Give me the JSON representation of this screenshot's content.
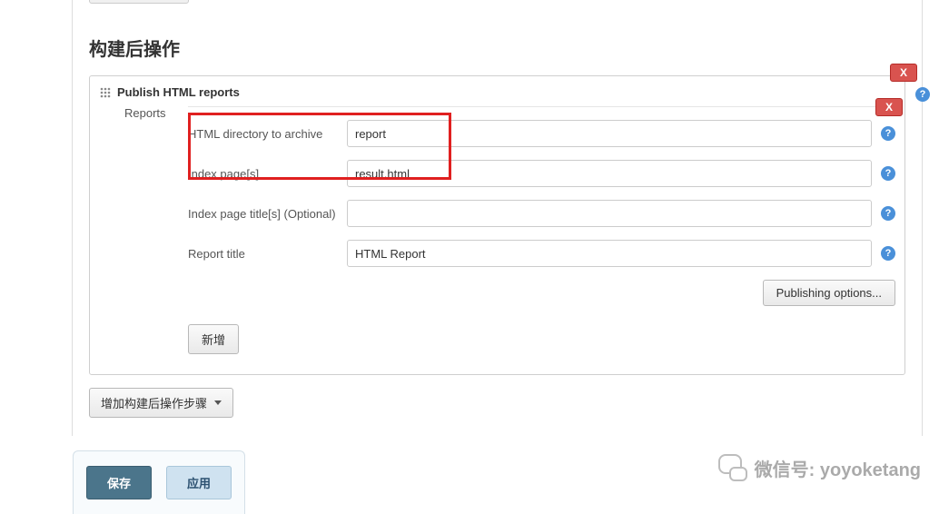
{
  "section": {
    "title": "构建后操作"
  },
  "panel": {
    "title": "Publish HTML reports",
    "reports_label": "Reports",
    "close_label": "X",
    "inner_close_label": "X"
  },
  "fields": {
    "html_dir": {
      "label": "HTML directory to archive",
      "value": "report"
    },
    "index_pages": {
      "label": "Index page[s]",
      "value": "result.html"
    },
    "index_titles": {
      "label": "Index page title[s] (Optional)",
      "value": ""
    },
    "report_title": {
      "label": "Report title",
      "value": "HTML Report"
    }
  },
  "buttons": {
    "publishing_options": "Publishing options...",
    "add": "新增",
    "add_post_step": "增加构建后操作步骤",
    "save": "保存",
    "apply": "应用"
  },
  "help_glyph": "?",
  "watermark": "微信号: yoyoketang"
}
